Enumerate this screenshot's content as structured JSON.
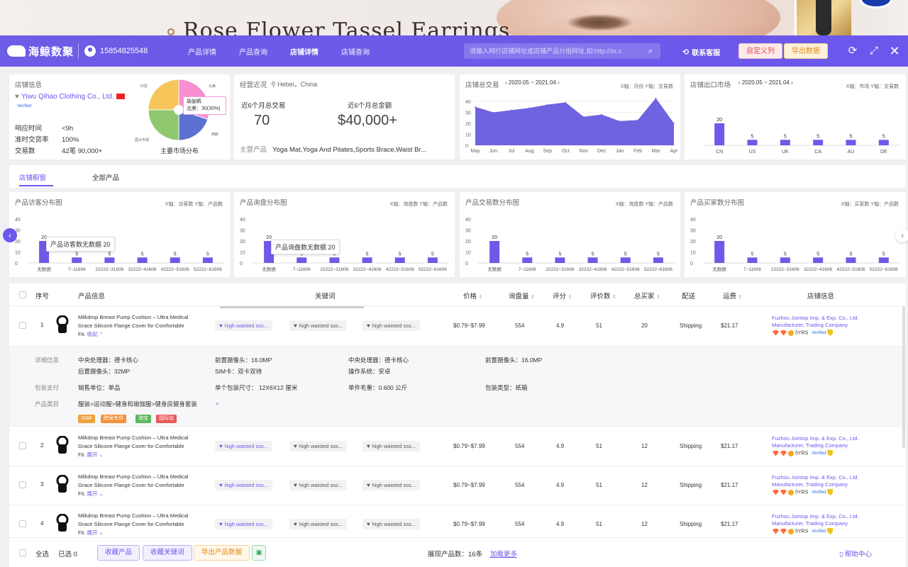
{
  "hero": {
    "title": "Rose Flower Tassel Earrings"
  },
  "topbar": {
    "logo_text": "海鲸数聚",
    "phone": "15854825548",
    "nav": [
      "产品详情",
      "产品查询",
      "店铺详情",
      "店铺查询"
    ],
    "search_placeholder": "请输入网行店铺网址或店铺产品分组网址,如:http://xx.c",
    "support": "联系客服",
    "custom_btn": "自定义列",
    "export_btn": "导出数据"
  },
  "store": {
    "title": "店铺信息",
    "name": "Yiwu Qihao Clothing Co., Ltd.",
    "verified": "Verified",
    "rows": [
      {
        "k": "响应时间",
        "v": "<9h"
      },
      {
        "k": "准时交货率",
        "v": "100%"
      },
      {
        "k": "交易数",
        "v": "42笔  90,000+"
      }
    ],
    "pie_caption": "主要市场分布",
    "pie_labels": [
      "印尼",
      "北美",
      "南美",
      "西欧",
      "国大市场"
    ],
    "pie_tip_title": "瑜伽裤",
    "pie_tip_value": "北美：30(30%)",
    "pie_colors": [
      "#f88fd0",
      "#5b72d3",
      "#8fc86f",
      "#f7c65a"
    ],
    "pie_values": [
      30,
      20,
      25,
      25
    ]
  },
  "overview": {
    "title": "经营近况",
    "location": "Hebei，China",
    "total_tx_label": "近6个月总交易",
    "total_tx_value": "70",
    "total_amount_label": "近6个月总金额",
    "total_amount_value": "$40,000+",
    "main_products_label": "主营产品",
    "main_products": "Yoga Mat,Yoga And Pilates,Sports Brace,Waist Br..."
  },
  "store_tx_chart": {
    "title": "店铺总交易",
    "range": "2020.05 ~ 2021.04",
    "axis_note": "X轴：月份    Y轴：交易数"
  },
  "export_chart": {
    "title": "店铺出口市场",
    "range": "2020.05 ~ 2021.04",
    "axis_note": "X轴：市场    Y轴：交易数"
  },
  "tabs": [
    "店铺橱窗",
    "全部产品"
  ],
  "dist_charts": [
    {
      "title": "产品访客分布图",
      "axis_note": "X轴：访客数    Y轴：产品数",
      "tooltip": "产品访客数无数据 20"
    },
    {
      "title": "产品询盘分布图",
      "axis_note": "X轴：询盘数    Y轴：产品数",
      "tooltip": "产品询盘数无数据 20"
    },
    {
      "title": "产品交易数分布图",
      "axis_note": "X轴：询盘数    Y轴：产品数",
      "tooltip": ""
    },
    {
      "title": "产品买家数分布图",
      "axis_note": "X轴：买家数    Y轴：产品数",
      "tooltip": ""
    }
  ],
  "chart_data": [
    {
      "type": "area",
      "title": "店铺总交易",
      "x": [
        "May",
        "Jun",
        "Jul",
        "Aug",
        "Sep",
        "Oct",
        "Nov",
        "Dec",
        "Jan",
        "Feb",
        "Mar",
        "Apr"
      ],
      "values": [
        35,
        30,
        32,
        34,
        37,
        39,
        26,
        28,
        22,
        23,
        43,
        20
      ],
      "ylim": [
        0,
        40
      ],
      "yticks": [
        0,
        10,
        20,
        30,
        40
      ],
      "color": "#6e64e0"
    },
    {
      "type": "bar",
      "title": "店铺出口市场",
      "categories": [
        "CN",
        "US",
        "UK",
        "CA",
        "AU",
        "DE"
      ],
      "values": [
        20,
        5,
        5,
        5,
        5,
        5
      ],
      "ylim": [
        0,
        40
      ],
      "color": "#6e5ae8"
    },
    {
      "type": "bar",
      "title": "产品访客分布图",
      "categories": [
        "无数据",
        "7~11606",
        "22222~31606",
        "32222~41606",
        "42222~51606",
        "52222~61606"
      ],
      "values": [
        20,
        5,
        5,
        5,
        5,
        5
      ],
      "ylim": [
        0,
        40
      ],
      "yticks": [
        0,
        10,
        20,
        30,
        40
      ],
      "color": "#6e5ae8"
    },
    {
      "type": "bar",
      "title": "产品询盘分布图",
      "categories": [
        "无数据",
        "7~11606",
        "22222~31606",
        "32222~41606",
        "42222~51606",
        "52222~61606"
      ],
      "values": [
        20,
        5,
        5,
        5,
        5,
        5
      ],
      "ylim": [
        0,
        40
      ],
      "yticks": [
        0,
        10,
        20,
        30,
        40
      ],
      "color": "#6e5ae8"
    },
    {
      "type": "bar",
      "title": "产品交易数分布图",
      "categories": [
        "无数据",
        "7~11606",
        "22222~31606",
        "32222~41606",
        "42222~51606",
        "52222~61606"
      ],
      "values": [
        20,
        5,
        5,
        5,
        5,
        5
      ],
      "ylim": [
        0,
        40
      ],
      "yticks": [
        0,
        10,
        20,
        30,
        40
      ],
      "color": "#6e5ae8"
    },
    {
      "type": "bar",
      "title": "产品买家数分布图",
      "categories": [
        "无数据",
        "7~11606",
        "22222~31606",
        "32222~41606",
        "42222~51606",
        "52222~61606"
      ],
      "values": [
        20,
        5,
        5,
        5,
        5,
        5
      ],
      "ylim": [
        0,
        40
      ],
      "yticks": [
        0,
        10,
        20,
        30,
        40
      ],
      "color": "#6e5ae8"
    }
  ],
  "table": {
    "headers": {
      "index": "序号",
      "product": "产品信息",
      "keywords": "关键词",
      "price": "价格",
      "inquiries": "询盘量",
      "rating": "评分",
      "reviews": "评价数",
      "buyers": "总买家",
      "shipping": "配送",
      "freight": "运费",
      "store": "店铺信息"
    },
    "rows": [
      {
        "index": "1",
        "title": "Milkdrop Breast Pump Cushion – Ultra Medical Grace Silicone Flange Cover for Comfortable Fit.",
        "toggle": "收起 ⌃",
        "kw": [
          "high waisted sss...",
          "high waisted sss...",
          "high waisted sss..."
        ],
        "price": "$0.79~$7.99",
        "inquiries": "554",
        "rating": "4.9",
        "reviews": "51",
        "buyers": "20",
        "shipping": "Shipping",
        "freight": "$21.17",
        "supplier": "Fuzhou Jointop Imp. & Exp. Co., Ltd.",
        "supplier_type": "Manufacturer, Trading Company",
        "years": "5YRS"
      },
      {
        "index": "2",
        "title": "Milkdrop Breast Pump Cushion – Ultra Medical Grace Silicone Flange Cover for Comfortable Fit.",
        "toggle": "展开 ⌄",
        "kw": [
          "high waisted sss...",
          "high waisted sss...",
          "high waisted sss..."
        ],
        "price": "$0.79~$7.99",
        "inquiries": "554",
        "rating": "4.9",
        "reviews": "51",
        "buyers": "12",
        "shipping": "Shipping",
        "freight": "$21.17",
        "supplier": "Fuzhou Jointop Imp. & Exp. Co., Ltd.",
        "supplier_type": "Manufacturer, Trading Company",
        "years": "5YRS"
      },
      {
        "index": "3",
        "title": "Milkdrop Breast Pump Cushion – Ultra Medical Grace Silicone Flange Cover for Comfortable Fit.",
        "toggle": "展开 ⌄",
        "kw": [
          "high waisted sss...",
          "high waisted sss...",
          "high waisted sss..."
        ],
        "price": "$0.79~$7.99",
        "inquiries": "554",
        "rating": "4.9",
        "reviews": "51",
        "buyers": "12",
        "shipping": "Shipping",
        "freight": "$21.17",
        "supplier": "Fuzhou Jointop Imp. & Exp. Co., Ltd.",
        "supplier_type": "Manufacturer, Trading Company",
        "years": "5YRS"
      },
      {
        "index": "4",
        "title": "Milkdrop Breast Pump Cushion – Ultra Medical Grace Silicone Flange Cover for Comfortable Fit.",
        "toggle": "展开 ⌄",
        "kw": [
          "high waisted sss...",
          "high waisted sss...",
          "high waisted sss..."
        ],
        "price": "$0.79~$7.99",
        "inquiries": "554",
        "rating": "4.9",
        "reviews": "51",
        "buyers": "12",
        "shipping": "Shipping",
        "freight": "$21.17",
        "supplier": "Fuzhou Jointop Imp. & Exp. Co., Ltd.",
        "supplier_type": "Manufacturer, Trading Company",
        "years": "5YRS"
      }
    ],
    "detail": {
      "label_detail": "详细信息",
      "label_pack": "包装支付",
      "label_category": "产品类目",
      "cpu1": "中央处理器：德卡核心",
      "camera1": "前置摄像头：16.0MP",
      "cpu2": "中央处理器：德卡核心",
      "camera2": "前置摄像头：16.0MP",
      "rear_camera": "后置摄像头：32MP",
      "sim": "SIM卡：双卡双待",
      "os": "操作系统：安卓",
      "unit": "销售单位：单品",
      "pkg_size": "单个包装尺寸：  12X6X12 厘米",
      "weight": "单件毛重：0.600 公斤",
      "pkg_type": "包装类型：纸箱",
      "category_path": "服装>运动服>健身和瑜伽服>健身房健身套装",
      "chips": [
        "1688",
        "跨境专供",
        "淘宝",
        "国际站"
      ]
    }
  },
  "footer": {
    "select_all": "全选",
    "selected": "已选 0",
    "fav_products": "收藏产品",
    "fav_keywords": "收藏关键词",
    "export_products": "导出产品数据",
    "shown": "展现产品数：16条",
    "load_more": "加载更多",
    "help": "帮助中心"
  }
}
